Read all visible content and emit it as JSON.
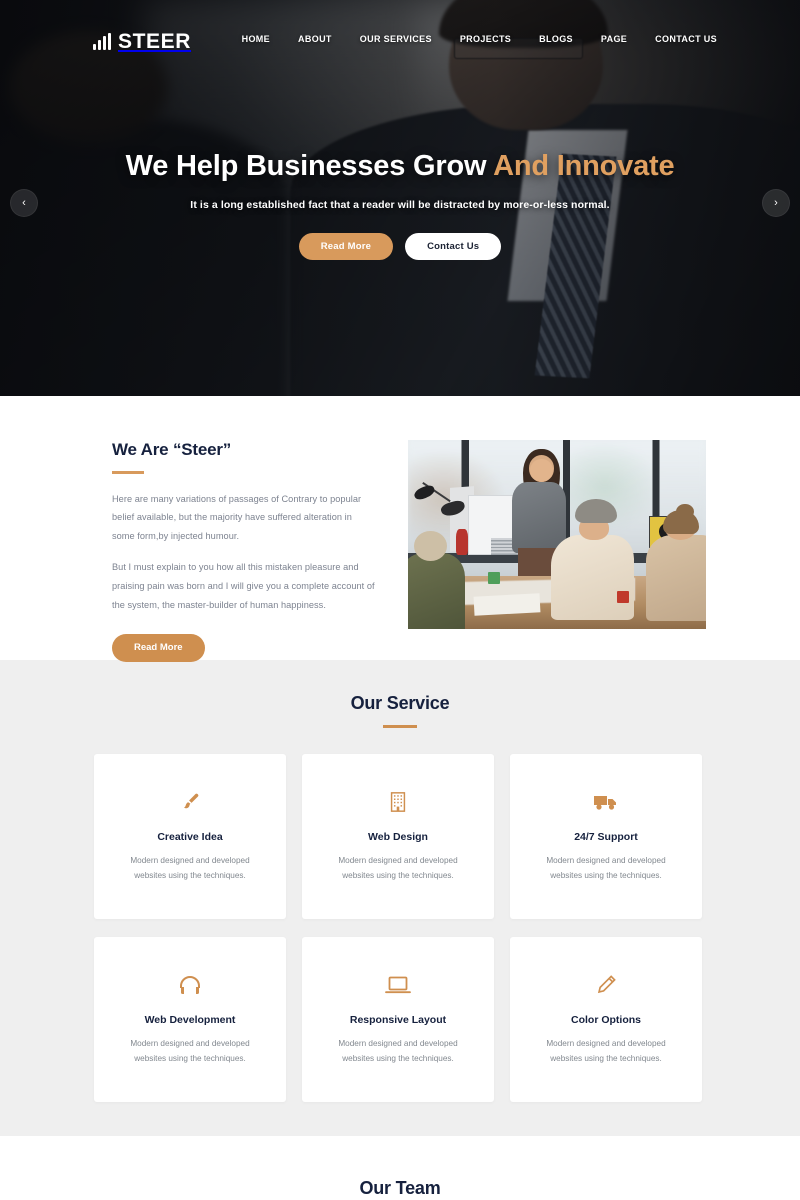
{
  "header": {
    "logo_text": "STEER",
    "logo_icon": "bar-chart-icon",
    "nav": [
      {
        "label": "HOME"
      },
      {
        "label": "ABOUT"
      },
      {
        "label": "OUR SERVICES"
      },
      {
        "label": "PROJECTS"
      },
      {
        "label": "BLOGS"
      },
      {
        "label": "PAGE"
      },
      {
        "label": "CONTACT US"
      }
    ]
  },
  "hero": {
    "title_white": "We Help Businesses Grow",
    "title_accent": "And Innovate",
    "subtitle": "It is a long established fact that a reader will be distracted by more-or-less normal.",
    "primary_button": "Read More",
    "secondary_button": "Contact Us",
    "prev_arrow": "‹",
    "next_arrow": "›"
  },
  "about": {
    "title": "We Are “Steer”",
    "paragraph_1": "Here are many variations of passages of Contrary to popular belief available, but the majority have suffered alteration in some form,by injected humour.",
    "paragraph_2": "But I must explain to you how all this mistaken pleasure and praising pain was born and I will give you a complete account of the system, the master-builder of human happiness.",
    "button": "Read More",
    "image_alt": "office-team-meeting-photo"
  },
  "services": {
    "title": "Our Service",
    "cards": [
      {
        "icon": "paint-brush-icon",
        "title": "Creative Idea",
        "desc": "Modern designed and developed websites using the techniques."
      },
      {
        "icon": "building-icon",
        "title": "Web Design",
        "desc": "Modern designed and developed websites using the techniques."
      },
      {
        "icon": "truck-icon",
        "title": "24/7 Support",
        "desc": "Modern designed and developed websites using the techniques."
      },
      {
        "icon": "headphones-icon",
        "title": "Web Development",
        "desc": "Modern designed and developed websites using the techniques."
      },
      {
        "icon": "laptop-icon",
        "title": "Responsive Layout",
        "desc": "Modern designed and developed websites using the techniques."
      },
      {
        "icon": "pencil-icon",
        "title": "Color Options",
        "desc": "Modern designed and developed websites using the techniques."
      }
    ]
  },
  "team": {
    "title": "Our Team"
  },
  "colors": {
    "accent": "#cf8f4f",
    "accent_light": "#d89a5c",
    "heading": "#16213e",
    "body_text": "#7d8390",
    "section_bg": "#efefef",
    "card_bg": "#ffffff"
  }
}
